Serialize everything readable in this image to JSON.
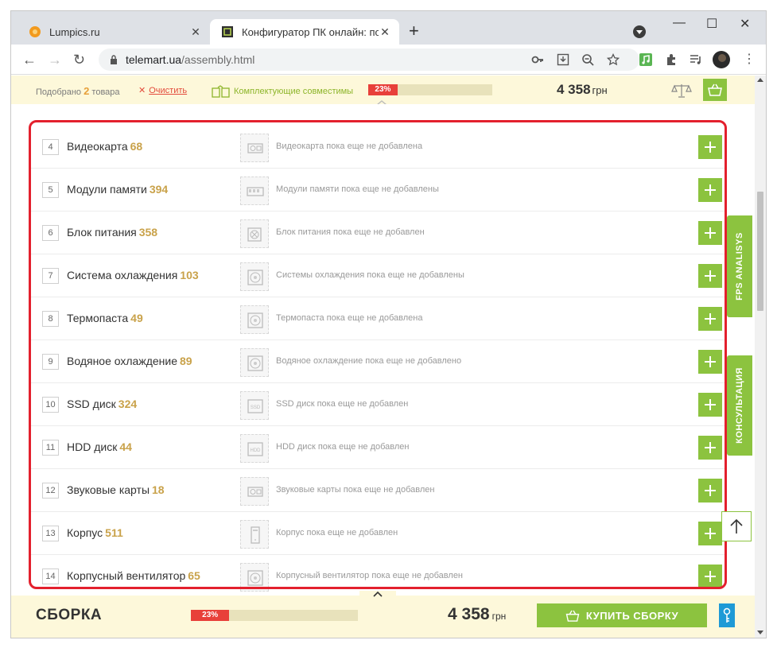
{
  "browser": {
    "tabs": [
      {
        "title": "Lumpics.ru",
        "active": false
      },
      {
        "title": "Конфигуратор ПК онлайн: подб",
        "active": true
      }
    ],
    "url_host": "telemart.ua",
    "url_path": "/assembly.html"
  },
  "topbar": {
    "selected_prefix": "Подобрано",
    "selected_count": "2",
    "selected_suffix": "товара",
    "clear_label": "Очистить",
    "compat_label": "Комплектующие совместимы",
    "progress_label": "23%",
    "progress_percent": 23,
    "price": "4 358",
    "currency": "грн"
  },
  "components": [
    {
      "num": "4",
      "name": "Видеокарта",
      "count": "68",
      "icon": "gpu-icon",
      "empty": "Видеокарта пока еще не добавлена"
    },
    {
      "num": "5",
      "name": "Модули памяти",
      "count": "394",
      "icon": "ram-icon",
      "empty": "Модули памяти пока еще не добавлены"
    },
    {
      "num": "6",
      "name": "Блок питания",
      "count": "358",
      "icon": "psu-icon",
      "empty": "Блок питания пока еще не добавлен"
    },
    {
      "num": "7",
      "name": "Система охлаждения",
      "count": "103",
      "icon": "fan-icon",
      "empty": "Системы охлаждения пока еще не добавлены"
    },
    {
      "num": "8",
      "name": "Термопаста",
      "count": "49",
      "icon": "fan-icon",
      "empty": "Термопаста пока еще не добавлена"
    },
    {
      "num": "9",
      "name": "Водяное охлаждение",
      "count": "89",
      "icon": "fan-icon",
      "empty": "Водяное охлаждение пока еще не добавлено"
    },
    {
      "num": "10",
      "name": "SSD диск",
      "count": "324",
      "icon": "ssd-icon",
      "empty": "SSD диск пока еще не добавлен"
    },
    {
      "num": "11",
      "name": "HDD диск",
      "count": "44",
      "icon": "hdd-icon",
      "empty": "HDD диск пока еще не добавлен"
    },
    {
      "num": "12",
      "name": "Звуковые карты",
      "count": "18",
      "icon": "soundcard-icon",
      "empty": "Звуковые карты пока еще не добавлен"
    },
    {
      "num": "13",
      "name": "Корпус",
      "count": "511",
      "icon": "case-icon",
      "empty": "Корпус пока еще не добавлен"
    },
    {
      "num": "14",
      "name": "Корпусный вентилятор",
      "count": "65",
      "icon": "fan-icon",
      "empty": "Корпусный вентилятор пока еще не добавлен"
    }
  ],
  "sidetabs": {
    "fps": "FPS ANALISYS",
    "consult": "КОНСУЛЬТАЦИЯ"
  },
  "bottombar": {
    "title": "СБОРКА",
    "progress_label": "23%",
    "progress_percent": 23,
    "price": "4 358",
    "currency": "грн",
    "buy_label": "КУПИТЬ СБОРКУ"
  },
  "colors": {
    "accent": "#8cc33f",
    "highlight": "#e3202d",
    "progress": "#e8403a",
    "count": "#c9a24a"
  }
}
